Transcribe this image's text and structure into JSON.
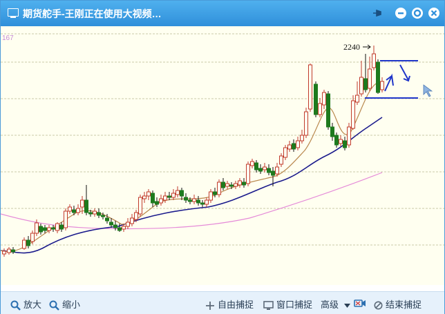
{
  "window": {
    "title": "期货舵手-王刚正在使用大视频…"
  },
  "chart": {
    "top_axis_label": "167",
    "peak_label": "2240"
  },
  "toolbar": {
    "zoom_in": "放大",
    "zoom_out": "缩小",
    "free_capture": "自由捕捉",
    "window_capture": "窗口捕捉",
    "advanced": "高级",
    "end_capture": "结束捕捉"
  },
  "colors": {
    "title_bar": "#3a9de3",
    "candle_up": "#c0392b",
    "candle_down": "#1e7a1e",
    "ma_short": "#b8864b",
    "ma_mid": "#1a1a8c",
    "ma_long": "#e58ad8",
    "annotation": "#1f35c9"
  }
}
